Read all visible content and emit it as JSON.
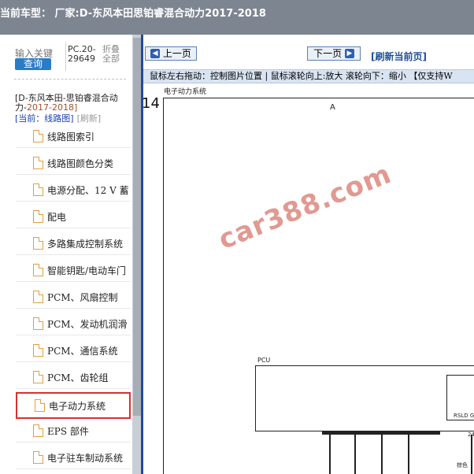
{
  "titlebar": {
    "text": "当前车型： 厂家:D-东风本田思铂睿混合动力2017-2018"
  },
  "left_panel": {
    "search_placeholder": "输入关键",
    "search_button": "查询",
    "pc_code": "PC.20-29649",
    "fold_toggle": "折叠全部",
    "model_name": "[D-东风本田-思铂睿混合动力-",
    "model_year": "2017-2018]",
    "current_label": "[当前：线路图]",
    "refresh_label": "[刷新]",
    "tree_items": [
      "线路图索引",
      "线路图颜色分类",
      "电源分配、12 V 蓄",
      "配电",
      "多路集成控制系统",
      "智能钥匙/电动车门",
      "PCM、风扇控制",
      "PCM、发动机润滑",
      "PCM、通信系统",
      "PCM、齿轮组",
      "电子动力系统",
      "EPS 部件",
      "电子驻车制动系统"
    ],
    "selected_item_index": 10
  },
  "toolbar": {
    "prev_label": "上一页",
    "next_label": "下一页",
    "refresh_label": "[刷新当前页]",
    "hint": "鼠标左右拖动：控制图片位置 | 鼠标滚轮向上:放大  滚轮向下：缩小 【仅支持W"
  },
  "diagram": {
    "title": "电子动力系统",
    "page_number": "14",
    "zone": "A",
    "pcu_label": "PCU",
    "rsld_label": "RSLD G",
    "pin_label": "24",
    "wire_color": "棕色",
    "watermark": "car388.com"
  },
  "colors": {
    "titlebar_bg": "#7d8591",
    "accent_blue": "#1f4d96",
    "selection_border": "#d93030",
    "watermark": "#c84637"
  },
  "icons": {
    "tree_item": "document-icon",
    "prev": "arrow-left-icon",
    "next": "arrow-right-icon"
  }
}
